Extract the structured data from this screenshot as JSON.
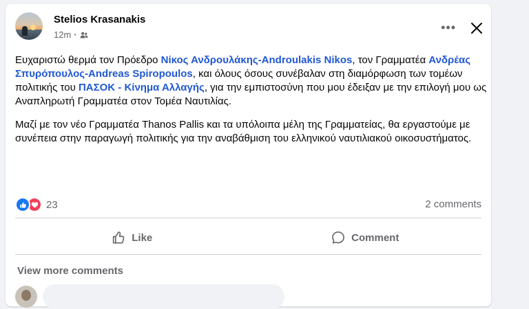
{
  "post": {
    "author": "Stelios Krasanakis",
    "time": "12m",
    "dot": "·",
    "audience_icon": "friends-icon",
    "more_label": "•••",
    "paragraph1": {
      "t1": "Ευχαριστώ θερμά τον Πρόεδρο ",
      "link1": "Νίκος Ανδρουλάκης-Androulakis Nikos",
      "t2": ", τον Γραμματέα  ",
      "link2": "Ανδρέας Σπυρόπουλος-Andreas Spiropoulos",
      "t3": ", και όλους όσους συνέβαλαν στη διαμόρφωση των τομέων πολιτικής του ",
      "link3": "ΠΑΣΟΚ - Κίνημα Αλλαγής",
      "t4": ", για την εμπιστοσύνη που μου έδειξαν με την επιλογή μου ως Αναπληρωτή Γραμματέα στον Τομέα Ναυτιλίας."
    },
    "paragraph2": "Μαζί με τον νέο Γραμματέα Thanos Pallis και τα υπόλοιπα μέλη της Γραμματείας, θα εργαστούμε με συνέπεια στην παραγωγή πολιτικής για την αναβάθμιση του ελληνικού ναυτιλιακού οικοσυστήματος."
  },
  "reactions": {
    "count": "23",
    "comments": "2 comments",
    "like_color": "#1877f2",
    "love_color": "#f33e58"
  },
  "actions": {
    "like": "Like",
    "comment": "Comment"
  },
  "comments_section": {
    "view_more": "View more comments"
  }
}
